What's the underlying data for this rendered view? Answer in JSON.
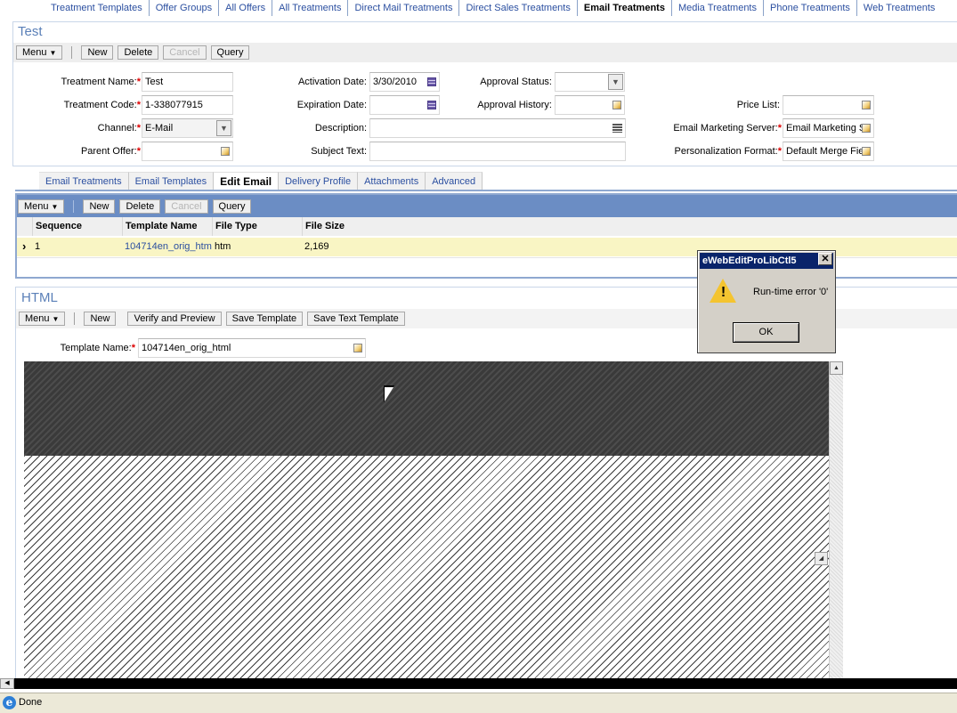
{
  "topnav": {
    "items": [
      "Treatment Templates",
      "Offer Groups",
      "All Offers",
      "All Treatments",
      "Direct Mail Treatments",
      "Direct Sales Treatments",
      "Email Treatments",
      "Media Treatments",
      "Phone Treatments",
      "Web Treatments"
    ],
    "active": "Email Treatments"
  },
  "form_applet": {
    "title": "Test",
    "buttons": {
      "menu": "Menu",
      "new": "New",
      "delete": "Delete",
      "cancel": "Cancel",
      "query": "Query"
    },
    "fields": {
      "treatment_name": {
        "label": "Treatment Name:",
        "value": "Test"
      },
      "treatment_code": {
        "label": "Treatment Code:",
        "value": "1-338077915"
      },
      "channel": {
        "label": "Channel:",
        "value": "E-Mail"
      },
      "parent_offer": {
        "label": "Parent Offer:",
        "value": ""
      },
      "activation_date": {
        "label": "Activation Date:",
        "value": "3/30/2010"
      },
      "expiration_date": {
        "label": "Expiration Date:",
        "value": ""
      },
      "description": {
        "label": "Description:",
        "value": ""
      },
      "subject_text": {
        "label": "Subject Text:",
        "value": ""
      },
      "approval_status": {
        "label": "Approval Status:",
        "value": ""
      },
      "approval_history": {
        "label": "Approval History:",
        "value": ""
      },
      "price_list": {
        "label": "Price List:",
        "value": ""
      },
      "email_marketing_server": {
        "label": "Email Marketing Server:",
        "value": "Email Marketing Se"
      },
      "personalization_format": {
        "label": "Personalization Format:",
        "value": "Default Merge Fie"
      }
    }
  },
  "tabs": [
    "Email Treatments",
    "Email Templates",
    "Edit Email",
    "Delivery Profile",
    "Attachments",
    "Advanced"
  ],
  "active_tab": "Edit Email",
  "list_applet": {
    "buttons": {
      "menu": "Menu",
      "new": "New",
      "delete": "Delete",
      "cancel": "Cancel",
      "query": "Query"
    },
    "columns": [
      "Sequence",
      "Template Name",
      "File Type",
      "File Size"
    ],
    "rows": [
      {
        "sequence": "1",
        "template_name": "104714en_orig_htm",
        "file_type": "htm",
        "file_size": "2,169"
      }
    ]
  },
  "html_applet": {
    "title": "HTML",
    "buttons": {
      "menu": "Menu",
      "new": "New",
      "verify": "Verify and Preview",
      "save_template": "Save Template",
      "save_text": "Save Text Template"
    },
    "template_name": {
      "label": "Template Name:",
      "value": "104714en_orig_html"
    }
  },
  "dialog": {
    "title": "eWebEditProLibCtl5",
    "message": "Run-time error '0'",
    "ok_label": "OK"
  },
  "statusbar": {
    "text": "Done"
  }
}
